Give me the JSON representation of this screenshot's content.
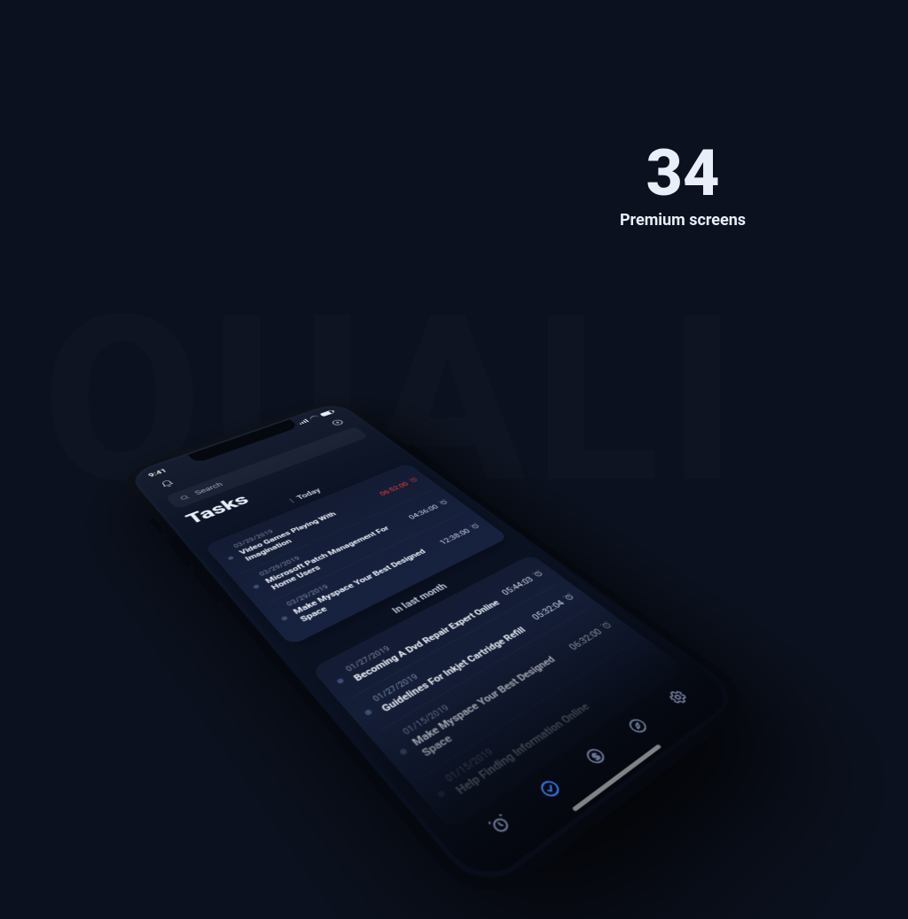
{
  "bg_word": "QUALI",
  "promo": {
    "number": "34",
    "subtitle": "Premium screens"
  },
  "status": {
    "time": "9:41"
  },
  "search": {
    "placeholder": "Search"
  },
  "title": "Tasks",
  "sections": {
    "today": {
      "label": "Today",
      "tasks": [
        {
          "date": "03/29/2019",
          "title": "Video Games Playing With Imagination",
          "time": "06:52:00",
          "soon": true
        },
        {
          "date": "03/29/2019",
          "title": "Microsoft Patch Management For Home Users",
          "time": "04:36:00",
          "soon": false
        },
        {
          "date": "03/29/2019",
          "title": "Make Myspace Your Best Designed Space",
          "time": "12:38:00",
          "soon": false
        }
      ]
    },
    "last_month": {
      "label": "In last month",
      "tasks": [
        {
          "date": "01/27/2019",
          "title": "Becoming A Dvd Repair Expert Online",
          "time": "05:44:03",
          "soon": false
        },
        {
          "date": "01/27/2019",
          "title": "Guidelines For Inkjet Cartridge Refill",
          "time": "05:32:04",
          "soon": false
        },
        {
          "date": "01/15/2019",
          "title": "Make Myspace Your Best Designed Space",
          "time": "06:32:00",
          "soon": false
        },
        {
          "date": "01/15/2019",
          "title": "Help Finding Information Online",
          "time": "",
          "soon": false
        }
      ]
    }
  }
}
